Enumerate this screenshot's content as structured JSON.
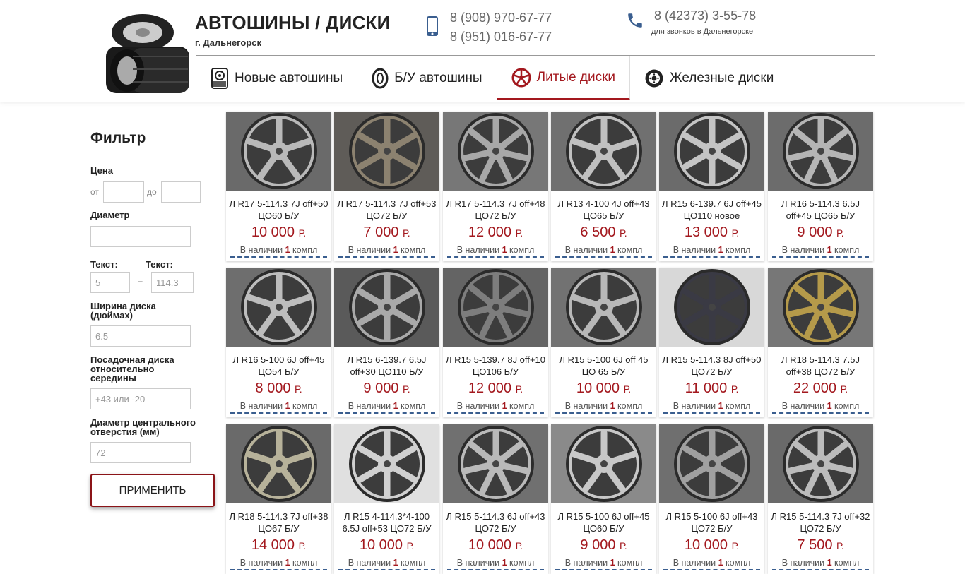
{
  "header": {
    "title": "АВТОШИНЫ / ДИСКИ",
    "city": "г. Дальнегорск",
    "phones": [
      "8 (908) 970-67-77",
      "8 (951) 016-67-77"
    ],
    "landline": "8 (42373) 3-55-78",
    "landline_note": "для звонков в Дальнегорске"
  },
  "nav": [
    {
      "label": "Новые автошины",
      "icon": "new-tire-icon"
    },
    {
      "label": "Б/У автошины",
      "icon": "used-tire-icon"
    },
    {
      "label": "Литые диски",
      "icon": "alloy-wheel-icon",
      "active": true
    },
    {
      "label": "Железные диски",
      "icon": "steel-wheel-icon"
    }
  ],
  "filter": {
    "title": "Фильтр",
    "price_label": "Цена",
    "from_label": "от",
    "to_label": "до",
    "diameter_label": "Диаметр",
    "text1_label": "Текст:",
    "text2_label": "Текст:",
    "text1_value": "5",
    "dash": "–",
    "text2_value": "114.3",
    "width_label": "Ширина диска (дюймах)",
    "width_value": "6.5",
    "offset_label": "Посадочная диска относительно середины",
    "offset_placeholder": "+43 или -20",
    "center_label": "Диаметр центрального отверстия (мм)",
    "center_value": "72",
    "apply_label": "ПРИМЕНИТЬ"
  },
  "stock_prefix": "В наличии",
  "stock_suffix": "компл",
  "currency": "Р.",
  "colors": {
    "accent": "#a3181e",
    "dashed": "#3a5e8f"
  },
  "products": [
    {
      "title": "Л R17 5-114.3 7J off+50 ЦО60 Б/У",
      "price": "10 000",
      "qty": "1"
    },
    {
      "title": "Л R17 5-114.3 7J off+53 ЦО72 Б/У",
      "price": "7 000",
      "qty": "1"
    },
    {
      "title": "Л R17 5-114.3 7J off+48 ЦО72 Б/У",
      "price": "12 000",
      "qty": "1"
    },
    {
      "title": "Л R13 4-100 4J off+43 ЦО65 Б/У",
      "price": "6 500",
      "qty": "1"
    },
    {
      "title": "Л R15 6-139.7 6J off+45 ЦО110 новое",
      "price": "13 000",
      "qty": "1"
    },
    {
      "title": "Л R16 5-114.3 6.5J off+45 ЦО65 Б/У",
      "price": "9 000",
      "qty": "1"
    },
    {
      "title": "Л R16 5-100 6J off+45 ЦО54 Б/У",
      "price": "8 000",
      "qty": "1"
    },
    {
      "title": "Л R15 6-139.7 6.5J off+30 ЦО110 Б/У",
      "price": "9 000",
      "qty": "1"
    },
    {
      "title": "Л R15 5-139.7 8J off+10 ЦО106 Б/У",
      "price": "12 000",
      "qty": "1"
    },
    {
      "title": "Л R15 5-100 6J off 45 ЦО 65 Б/У",
      "price": "10 000",
      "qty": "1"
    },
    {
      "title": "Л R15 5-114.3 8J off+50 ЦО72 Б/У",
      "price": "11 000",
      "qty": "1"
    },
    {
      "title": "Л R18 5-114.3 7.5J off+38 ЦО72 Б/У",
      "price": "22 000",
      "qty": "1"
    },
    {
      "title": "Л R18 5-114.3 7J off+38 ЦО67 Б/У",
      "price": "14 000",
      "qty": "1"
    },
    {
      "title": "Л R15 4-114.3*4-100 6.5J off+53 ЦО72 Б/У",
      "price": "10 000",
      "qty": "1"
    },
    {
      "title": "Л R15 5-114.3 6J off+43 ЦО72 Б/У",
      "price": "10 000",
      "qty": "1"
    },
    {
      "title": "Л R15 5-100 6J off+45 ЦО60 Б/У",
      "price": "9 000",
      "qty": "1"
    },
    {
      "title": "Л R15 5-100 6J off+43 ЦО72 Б/У",
      "price": "10 000",
      "qty": "1"
    },
    {
      "title": "Л R15 5-114.3 7J off+32 ЦО72 Б/У",
      "price": "7 500",
      "qty": "1"
    }
  ]
}
